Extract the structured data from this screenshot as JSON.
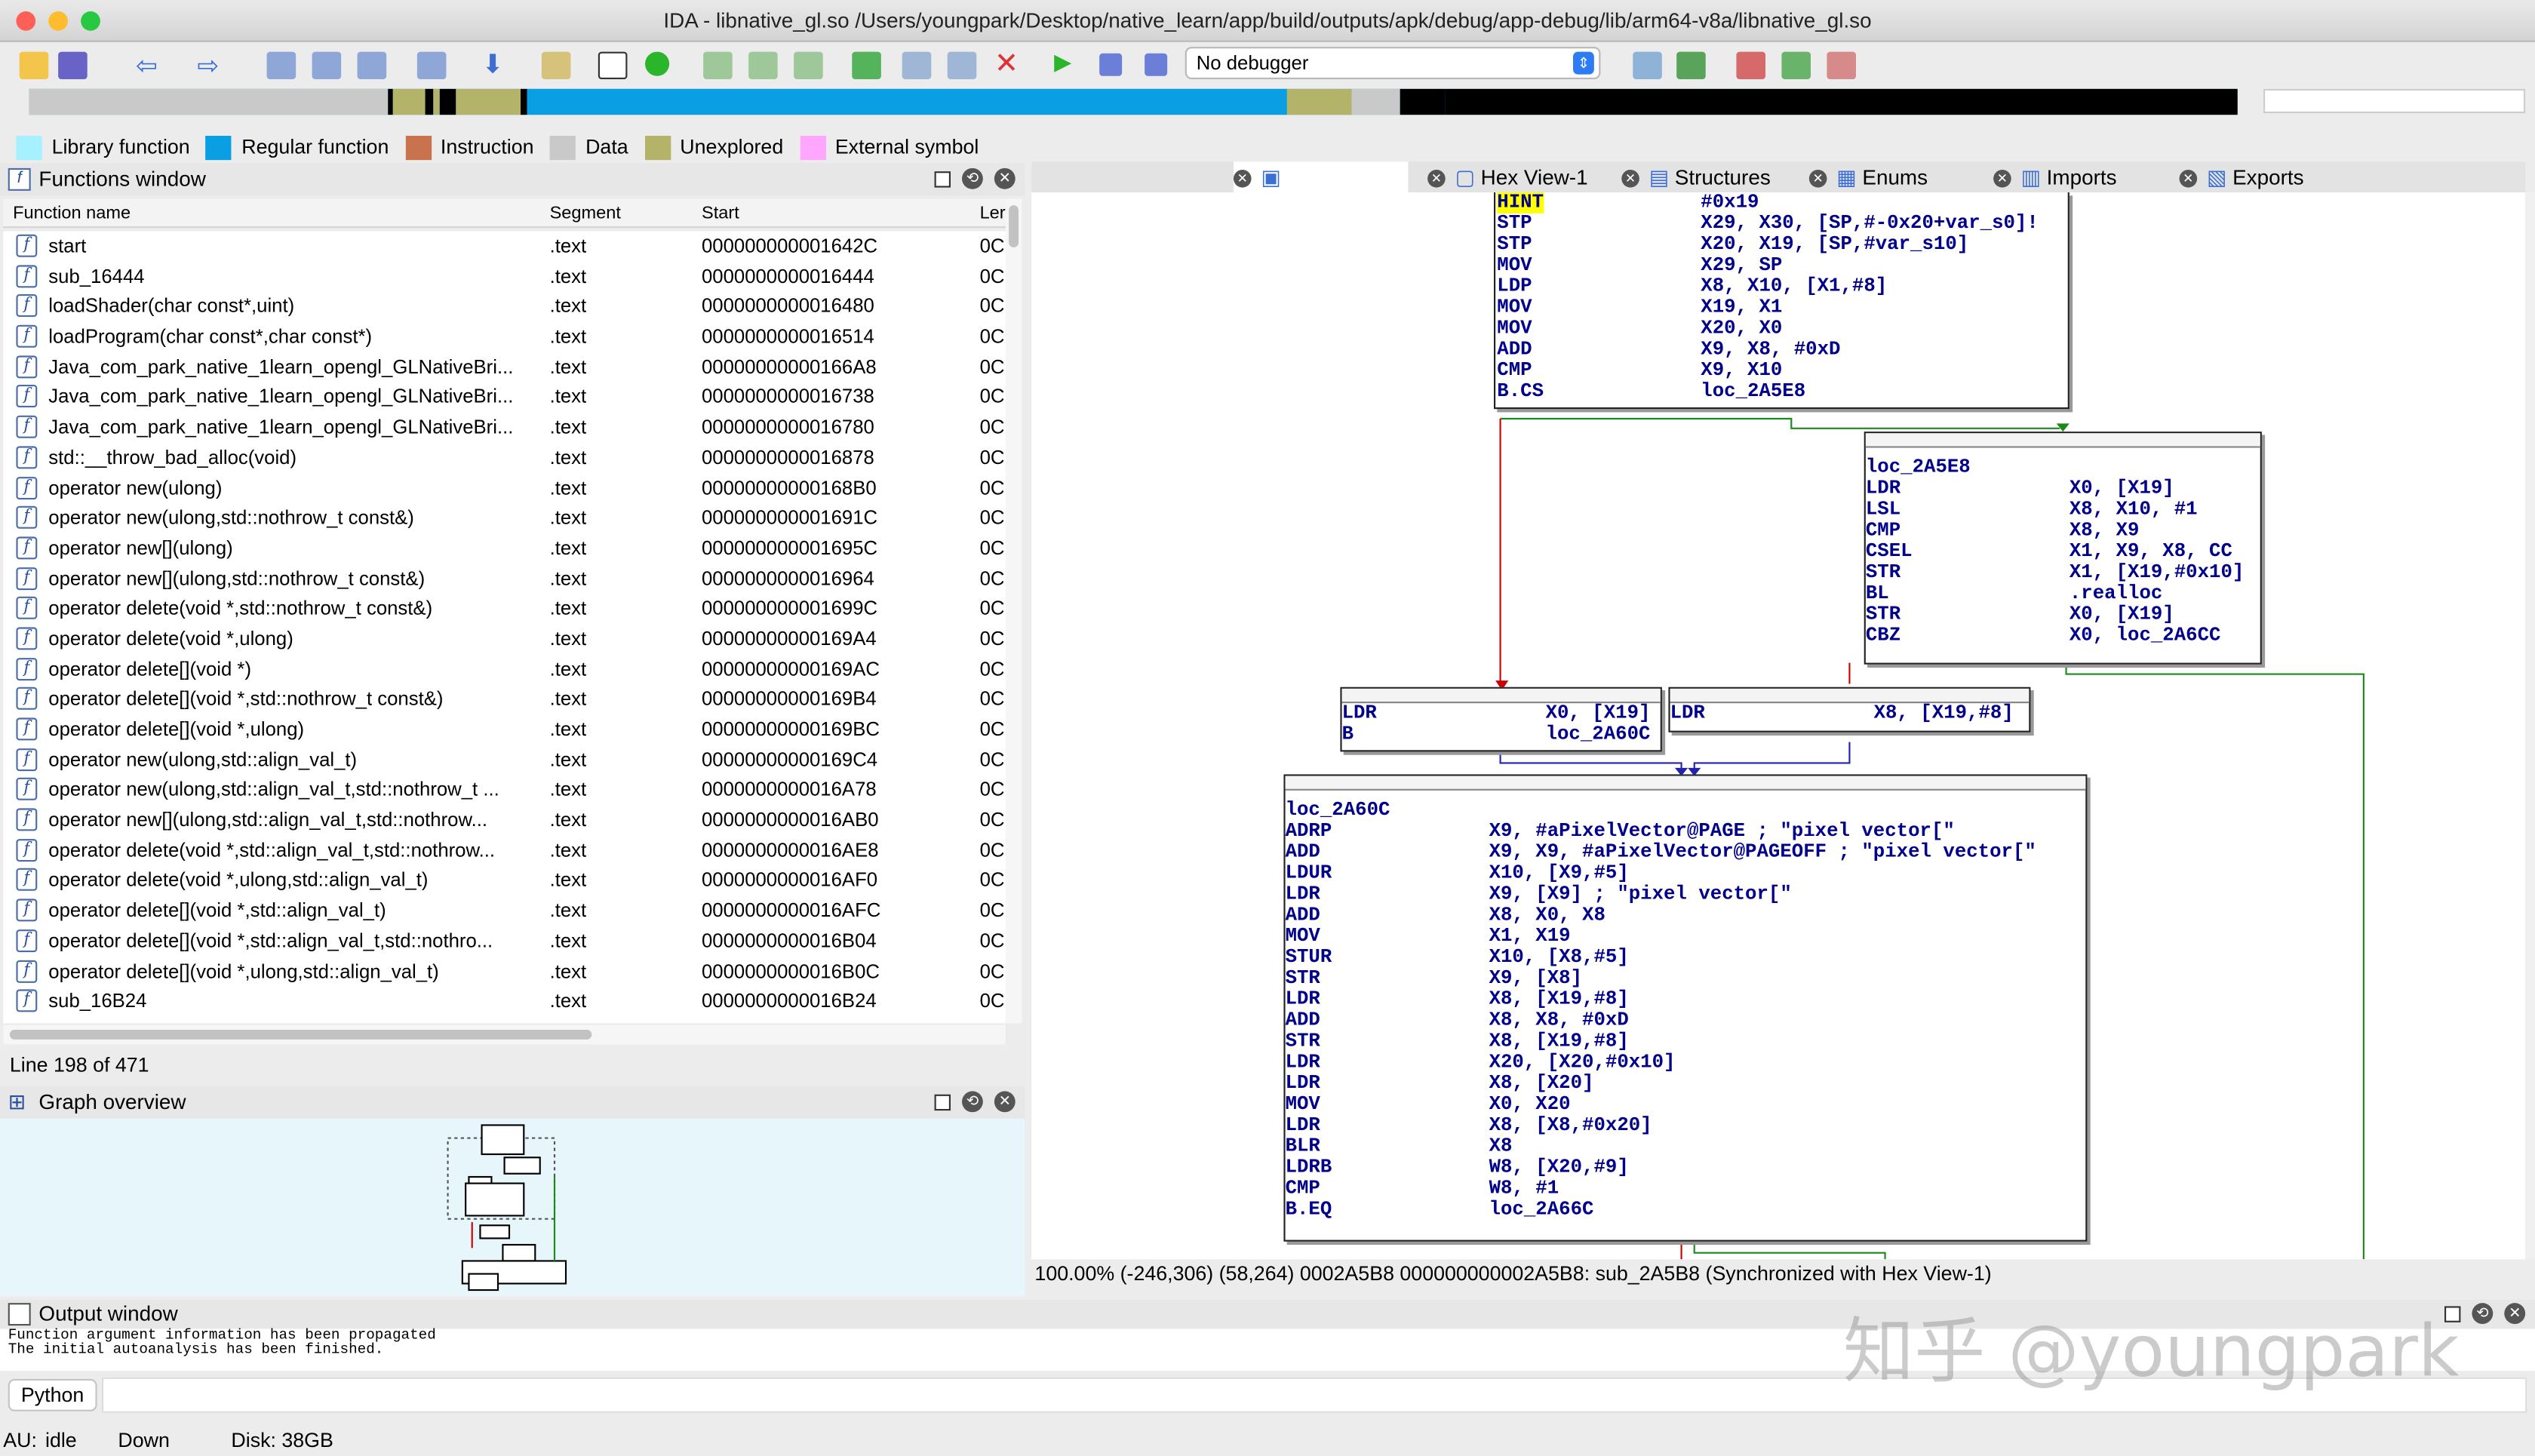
{
  "window": {
    "title": "IDA - libnative_gl.so /Users/youngpark/Desktop/native_learn/app/build/outputs/apk/debug/app-debug/lib/arm64-v8a/libnative_gl.so"
  },
  "toolbar": {
    "debugger_select": "No debugger"
  },
  "legend": [
    {
      "label": "Library function",
      "color": "#a6f1ff"
    },
    {
      "label": "Regular function",
      "color": "#0a9fe3"
    },
    {
      "label": "Instruction",
      "color": "#c8734e"
    },
    {
      "label": "Data",
      "color": "#c9c9c9"
    },
    {
      "label": "Unexplored",
      "color": "#b3b36a"
    },
    {
      "label": "External symbol",
      "color": "#ffa6ff"
    }
  ],
  "functions_window": {
    "title": "Functions window",
    "columns": [
      "Function name",
      "Segment",
      "Start",
      "Ler"
    ],
    "rows": [
      {
        "name": "start",
        "segment": ".text",
        "start": "000000000001642C",
        "len": "0C"
      },
      {
        "name": "sub_16444",
        "segment": ".text",
        "start": "0000000000016444",
        "len": "0C"
      },
      {
        "name": "loadShader(char const*,uint)",
        "segment": ".text",
        "start": "0000000000016480",
        "len": "0C"
      },
      {
        "name": "loadProgram(char const*,char const*)",
        "segment": ".text",
        "start": "0000000000016514",
        "len": "0C"
      },
      {
        "name": "Java_com_park_native_1learn_opengl_GLNativeBri...",
        "segment": ".text",
        "start": "00000000000166A8",
        "len": "0C"
      },
      {
        "name": "Java_com_park_native_1learn_opengl_GLNativeBri...",
        "segment": ".text",
        "start": "0000000000016738",
        "len": "0C"
      },
      {
        "name": "Java_com_park_native_1learn_opengl_GLNativeBri...",
        "segment": ".text",
        "start": "0000000000016780",
        "len": "0C"
      },
      {
        "name": "std::__throw_bad_alloc(void)",
        "segment": ".text",
        "start": "0000000000016878",
        "len": "0C"
      },
      {
        "name": "operator new(ulong)",
        "segment": ".text",
        "start": "00000000000168B0",
        "len": "0C"
      },
      {
        "name": "operator new(ulong,std::nothrow_t const&)",
        "segment": ".text",
        "start": "000000000001691C",
        "len": "0C"
      },
      {
        "name": "operator new[](ulong)",
        "segment": ".text",
        "start": "000000000001695C",
        "len": "0C"
      },
      {
        "name": "operator new[](ulong,std::nothrow_t const&)",
        "segment": ".text",
        "start": "0000000000016964",
        "len": "0C"
      },
      {
        "name": "operator delete(void *,std::nothrow_t const&)",
        "segment": ".text",
        "start": "000000000001699C",
        "len": "0C"
      },
      {
        "name": "operator delete(void *,ulong)",
        "segment": ".text",
        "start": "00000000000169A4",
        "len": "0C"
      },
      {
        "name": "operator delete[](void *)",
        "segment": ".text",
        "start": "00000000000169AC",
        "len": "0C"
      },
      {
        "name": "operator delete[](void *,std::nothrow_t const&)",
        "segment": ".text",
        "start": "00000000000169B4",
        "len": "0C"
      },
      {
        "name": "operator delete[](void *,ulong)",
        "segment": ".text",
        "start": "00000000000169BC",
        "len": "0C"
      },
      {
        "name": "operator new(ulong,std::align_val_t)",
        "segment": ".text",
        "start": "00000000000169C4",
        "len": "0C"
      },
      {
        "name": "operator new(ulong,std::align_val_t,std::nothrow_t ...",
        "segment": ".text",
        "start": "0000000000016A78",
        "len": "0C"
      },
      {
        "name": "operator new[](ulong,std::align_val_t,std::nothrow...",
        "segment": ".text",
        "start": "0000000000016AB0",
        "len": "0C"
      },
      {
        "name": "operator delete(void *,std::align_val_t,std::nothrow...",
        "segment": ".text",
        "start": "0000000000016AE8",
        "len": "0C"
      },
      {
        "name": "operator delete(void *,ulong,std::align_val_t)",
        "segment": ".text",
        "start": "0000000000016AF0",
        "len": "0C"
      },
      {
        "name": "operator delete[](void *,std::align_val_t)",
        "segment": ".text",
        "start": "0000000000016AFC",
        "len": "0C"
      },
      {
        "name": "operator delete[](void *,std::align_val_t,std::nothro...",
        "segment": ".text",
        "start": "0000000000016B04",
        "len": "0C"
      },
      {
        "name": "operator delete[](void *,ulong,std::align_val_t)",
        "segment": ".text",
        "start": "0000000000016B0C",
        "len": "0C"
      },
      {
        "name": "sub_16B24",
        "segment": ".text",
        "start": "0000000000016B24",
        "len": "0C"
      }
    ],
    "status": "Line 198 of 471"
  },
  "graph_overview": {
    "title": "Graph overview"
  },
  "tabs": [
    "Hex View-1",
    "Structures",
    "Enums",
    "Imports",
    "Exports"
  ],
  "blocks": {
    "b1": [
      [
        "HINT",
        "#0x19"
      ],
      [
        "STP",
        "X29, X30, [SP,#-0x20+var_s0]!"
      ],
      [
        "STP",
        "X20, X19, [SP,#var_s10]"
      ],
      [
        "MOV",
        "X29, SP"
      ],
      [
        "LDP",
        "X8, X10, [X1,#8]"
      ],
      [
        "MOV",
        "X19, X1"
      ],
      [
        "MOV",
        "X20, X0"
      ],
      [
        "ADD",
        "X9, X8, #0xD"
      ],
      [
        "CMP",
        "X9, X10"
      ],
      [
        "B.CS",
        "loc_2A5E8"
      ]
    ],
    "b2_label": "loc_2A5E8",
    "b2": [
      [
        "LDR",
        "X0, [X19]"
      ],
      [
        "LSL",
        "X8, X10, #1"
      ],
      [
        "CMP",
        "X8, X9"
      ],
      [
        "CSEL",
        "X1, X9, X8, CC"
      ],
      [
        "STR",
        "X1, [X19,#0x10]"
      ],
      [
        "BL",
        ".realloc"
      ],
      [
        "STR",
        "X0, [X19]"
      ],
      [
        "CBZ",
        "X0, loc_2A6CC"
      ]
    ],
    "b3": [
      [
        "LDR",
        "X0, [X19]"
      ],
      [
        "B",
        "loc_2A60C"
      ]
    ],
    "b4": [
      [
        "LDR",
        "X8, [X19,#8]"
      ]
    ],
    "b5_label": "loc_2A60C",
    "b5": [
      [
        "ADRP",
        "X9, #aPixelVector@PAGE ; \"pixel vector[\""
      ],
      [
        "ADD",
        "X9, X9, #aPixelVector@PAGEOFF ; \"pixel vector[\""
      ],
      [
        "LDUR",
        "X10, [X9,#5]"
      ],
      [
        "LDR",
        "X9, [X9] ; \"pixel vector[\""
      ],
      [
        "ADD",
        "X8, X0, X8"
      ],
      [
        "MOV",
        "X1, X19"
      ],
      [
        "STUR",
        "X10, [X8,#5]"
      ],
      [
        "STR",
        "X9, [X8]"
      ],
      [
        "LDR",
        "X8, [X19,#8]"
      ],
      [
        "ADD",
        "X8, X8, #0xD"
      ],
      [
        "STR",
        "X8, [X19,#8]"
      ],
      [
        "LDR",
        "X20, [X20,#0x10]"
      ],
      [
        "LDR",
        "X8, [X20]"
      ],
      [
        "MOV",
        "X0, X20"
      ],
      [
        "LDR",
        "X8, [X8,#0x20]"
      ],
      [
        "BLR",
        "X8"
      ],
      [
        "LDRB",
        "W8, [X20,#9]"
      ],
      [
        "CMP",
        "W8, #1"
      ],
      [
        "B.EQ",
        "loc_2A66C"
      ]
    ]
  },
  "graph_status": "100.00% (-246,306) (58,264) 0002A5B8 000000000002A5B8: sub_2A5B8 (Synchronized with Hex View-1)",
  "output_window": {
    "title": "Output window",
    "lines": [
      "Function argument information has been propagated",
      "The initial autoanalysis has been finished."
    ]
  },
  "python_button": "Python",
  "footer": {
    "au": "AU:",
    "state": "idle",
    "dir": "Down",
    "disk": "Disk: 38GB"
  },
  "watermark": "知乎 @youngpark"
}
